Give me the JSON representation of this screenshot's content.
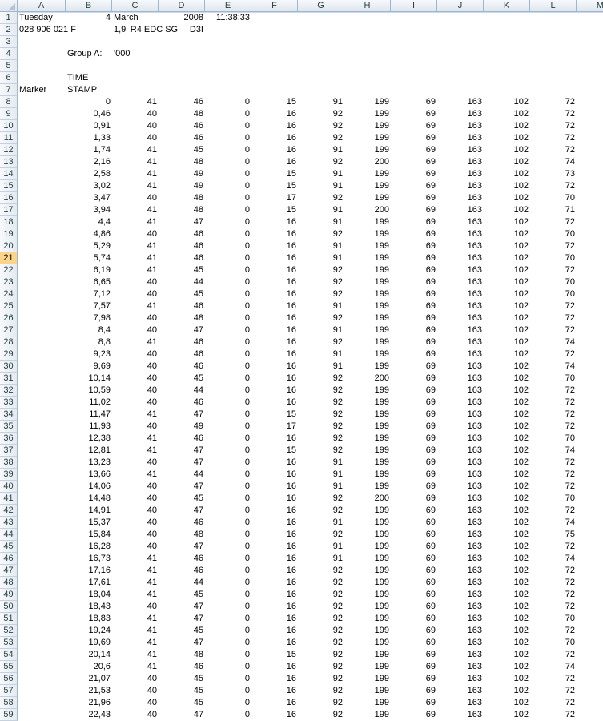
{
  "columns": [
    "A",
    "B",
    "C",
    "D",
    "E",
    "F",
    "G",
    "H",
    "I",
    "J",
    "K",
    "L",
    "M"
  ],
  "active_row": 21,
  "text_cells": [
    {
      "row": 1,
      "col": "A",
      "value": "Tuesday",
      "align": "left"
    },
    {
      "row": 1,
      "col": "B",
      "value": "4",
      "align": "right"
    },
    {
      "row": 1,
      "col": "C",
      "value": "March",
      "align": "left"
    },
    {
      "row": 1,
      "col": "D",
      "value": "2008",
      "align": "right"
    },
    {
      "row": 1,
      "col": "E",
      "value": "11:38:33",
      "align": "right"
    },
    {
      "row": 2,
      "col": "A",
      "value": "028 906 021 F",
      "align": "left"
    },
    {
      "row": 2,
      "col": "C",
      "value": "1,9l R4 EDC SG",
      "align": "left"
    },
    {
      "row": 2,
      "col": "D",
      "value": "D3I",
      "align": "right"
    },
    {
      "row": 4,
      "col": "B",
      "value": "Group A:",
      "align": "left"
    },
    {
      "row": 4,
      "col": "C",
      "value": "'000",
      "align": "left"
    },
    {
      "row": 6,
      "col": "B",
      "value": "TIME",
      "align": "left"
    },
    {
      "row": 7,
      "col": "A",
      "value": "Marker",
      "align": "left"
    },
    {
      "row": 7,
      "col": "B",
      "value": "STAMP",
      "align": "left"
    }
  ],
  "data_start_row": 8,
  "data_rows": [
    [
      "0",
      "41",
      "46",
      "0",
      "15",
      "91",
      "199",
      "69",
      "163",
      "102",
      "72"
    ],
    [
      "0,46",
      "40",
      "48",
      "0",
      "16",
      "92",
      "199",
      "69",
      "163",
      "102",
      "72"
    ],
    [
      "0,91",
      "40",
      "46",
      "0",
      "16",
      "92",
      "199",
      "69",
      "163",
      "102",
      "72"
    ],
    [
      "1,33",
      "40",
      "46",
      "0",
      "16",
      "92",
      "199",
      "69",
      "163",
      "102",
      "72"
    ],
    [
      "1,74",
      "41",
      "45",
      "0",
      "16",
      "91",
      "199",
      "69",
      "163",
      "102",
      "72"
    ],
    [
      "2,16",
      "41",
      "48",
      "0",
      "16",
      "92",
      "200",
      "69",
      "163",
      "102",
      "74"
    ],
    [
      "2,58",
      "41",
      "49",
      "0",
      "15",
      "91",
      "199",
      "69",
      "163",
      "102",
      "73"
    ],
    [
      "3,02",
      "41",
      "49",
      "0",
      "15",
      "91",
      "199",
      "69",
      "163",
      "102",
      "72"
    ],
    [
      "3,47",
      "40",
      "48",
      "0",
      "17",
      "92",
      "199",
      "69",
      "163",
      "102",
      "70"
    ],
    [
      "3,94",
      "41",
      "48",
      "0",
      "15",
      "91",
      "200",
      "69",
      "163",
      "102",
      "71"
    ],
    [
      "4,4",
      "41",
      "47",
      "0",
      "16",
      "91",
      "199",
      "69",
      "163",
      "102",
      "72"
    ],
    [
      "4,86",
      "40",
      "46",
      "0",
      "16",
      "92",
      "199",
      "69",
      "163",
      "102",
      "70"
    ],
    [
      "5,29",
      "41",
      "46",
      "0",
      "16",
      "91",
      "199",
      "69",
      "163",
      "102",
      "72"
    ],
    [
      "5,74",
      "41",
      "46",
      "0",
      "16",
      "91",
      "199",
      "69",
      "163",
      "102",
      "70"
    ],
    [
      "6,19",
      "41",
      "45",
      "0",
      "16",
      "92",
      "199",
      "69",
      "163",
      "102",
      "72"
    ],
    [
      "6,65",
      "40",
      "44",
      "0",
      "16",
      "92",
      "199",
      "69",
      "163",
      "102",
      "70"
    ],
    [
      "7,12",
      "40",
      "45",
      "0",
      "16",
      "92",
      "199",
      "69",
      "163",
      "102",
      "70"
    ],
    [
      "7,57",
      "41",
      "46",
      "0",
      "16",
      "91",
      "199",
      "69",
      "163",
      "102",
      "72"
    ],
    [
      "7,98",
      "40",
      "48",
      "0",
      "16",
      "92",
      "199",
      "69",
      "163",
      "102",
      "72"
    ],
    [
      "8,4",
      "40",
      "47",
      "0",
      "16",
      "91",
      "199",
      "69",
      "163",
      "102",
      "72"
    ],
    [
      "8,8",
      "41",
      "46",
      "0",
      "16",
      "92",
      "199",
      "69",
      "163",
      "102",
      "74"
    ],
    [
      "9,23",
      "40",
      "46",
      "0",
      "16",
      "91",
      "199",
      "69",
      "163",
      "102",
      "72"
    ],
    [
      "9,69",
      "40",
      "46",
      "0",
      "16",
      "91",
      "199",
      "69",
      "163",
      "102",
      "74"
    ],
    [
      "10,14",
      "40",
      "45",
      "0",
      "16",
      "92",
      "200",
      "69",
      "163",
      "102",
      "70"
    ],
    [
      "10,59",
      "40",
      "44",
      "0",
      "16",
      "92",
      "199",
      "69",
      "163",
      "102",
      "72"
    ],
    [
      "11,02",
      "40",
      "46",
      "0",
      "16",
      "92",
      "199",
      "69",
      "163",
      "102",
      "72"
    ],
    [
      "11,47",
      "41",
      "47",
      "0",
      "15",
      "92",
      "199",
      "69",
      "163",
      "102",
      "72"
    ],
    [
      "11,93",
      "40",
      "49",
      "0",
      "17",
      "92",
      "199",
      "69",
      "163",
      "102",
      "72"
    ],
    [
      "12,38",
      "41",
      "46",
      "0",
      "16",
      "92",
      "199",
      "69",
      "163",
      "102",
      "70"
    ],
    [
      "12,81",
      "41",
      "47",
      "0",
      "15",
      "92",
      "199",
      "69",
      "163",
      "102",
      "74"
    ],
    [
      "13,23",
      "40",
      "47",
      "0",
      "16",
      "91",
      "199",
      "69",
      "163",
      "102",
      "72"
    ],
    [
      "13,66",
      "41",
      "44",
      "0",
      "16",
      "91",
      "199",
      "69",
      "163",
      "102",
      "72"
    ],
    [
      "14,06",
      "40",
      "47",
      "0",
      "16",
      "91",
      "199",
      "69",
      "163",
      "102",
      "72"
    ],
    [
      "14,48",
      "40",
      "45",
      "0",
      "16",
      "92",
      "200",
      "69",
      "163",
      "102",
      "70"
    ],
    [
      "14,91",
      "40",
      "47",
      "0",
      "16",
      "92",
      "199",
      "69",
      "163",
      "102",
      "72"
    ],
    [
      "15,37",
      "40",
      "46",
      "0",
      "16",
      "91",
      "199",
      "69",
      "163",
      "102",
      "74"
    ],
    [
      "15,84",
      "40",
      "48",
      "0",
      "16",
      "92",
      "199",
      "69",
      "163",
      "102",
      "75"
    ],
    [
      "16,28",
      "40",
      "47",
      "0",
      "16",
      "91",
      "199",
      "69",
      "163",
      "102",
      "72"
    ],
    [
      "16,73",
      "41",
      "46",
      "0",
      "16",
      "91",
      "199",
      "69",
      "163",
      "102",
      "74"
    ],
    [
      "17,16",
      "41",
      "46",
      "0",
      "16",
      "92",
      "199",
      "69",
      "163",
      "102",
      "72"
    ],
    [
      "17,61",
      "41",
      "44",
      "0",
      "16",
      "92",
      "199",
      "69",
      "163",
      "102",
      "72"
    ],
    [
      "18,04",
      "41",
      "45",
      "0",
      "16",
      "92",
      "199",
      "69",
      "163",
      "102",
      "72"
    ],
    [
      "18,43",
      "40",
      "47",
      "0",
      "16",
      "92",
      "199",
      "69",
      "163",
      "102",
      "72"
    ],
    [
      "18,83",
      "41",
      "47",
      "0",
      "16",
      "92",
      "199",
      "69",
      "163",
      "102",
      "70"
    ],
    [
      "19,24",
      "41",
      "45",
      "0",
      "16",
      "92",
      "199",
      "69",
      "163",
      "102",
      "72"
    ],
    [
      "19,69",
      "41",
      "47",
      "0",
      "16",
      "92",
      "199",
      "69",
      "163",
      "102",
      "70"
    ],
    [
      "20,14",
      "41",
      "48",
      "0",
      "15",
      "92",
      "199",
      "69",
      "163",
      "102",
      "72"
    ],
    [
      "20,6",
      "41",
      "46",
      "0",
      "16",
      "92",
      "199",
      "69",
      "163",
      "102",
      "74"
    ],
    [
      "21,07",
      "40",
      "45",
      "0",
      "16",
      "92",
      "199",
      "69",
      "163",
      "102",
      "72"
    ],
    [
      "21,53",
      "40",
      "45",
      "0",
      "16",
      "92",
      "199",
      "69",
      "163",
      "102",
      "72"
    ],
    [
      "21,96",
      "40",
      "45",
      "0",
      "16",
      "92",
      "199",
      "69",
      "163",
      "102",
      "72"
    ],
    [
      "22,43",
      "40",
      "47",
      "0",
      "16",
      "92",
      "199",
      "69",
      "163",
      "102",
      "72"
    ]
  ]
}
